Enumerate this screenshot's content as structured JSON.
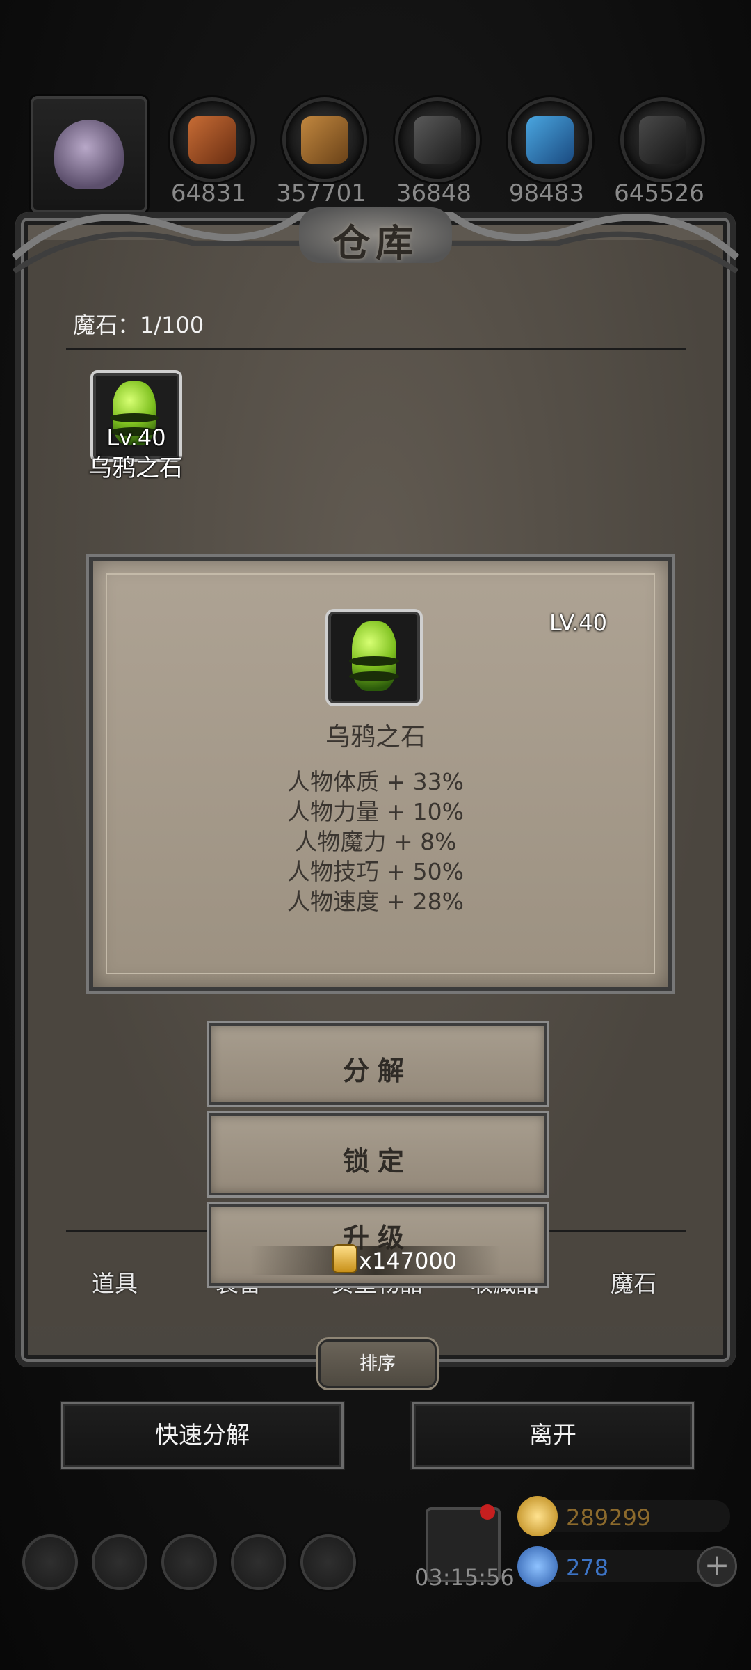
{
  "resources": {
    "values": [
      "64831",
      "357701",
      "36848",
      "98483",
      "645526"
    ]
  },
  "warehouse": {
    "title": "仓库",
    "capacity_label": "魔石：1/100"
  },
  "inventory": {
    "items": [
      {
        "level": "Lv.40",
        "name": "乌鸦之石"
      }
    ]
  },
  "detail": {
    "level": "LV.40",
    "name": "乌鸦之石",
    "stats": [
      "人物体质 + 33%",
      "人物力量 + 10%",
      "人物魔力 + 8%",
      "人物技巧 + 50%",
      "人物速度 + 28%"
    ]
  },
  "actions": {
    "decompose": "分解",
    "lock": "锁定",
    "upgrade": "升级",
    "upgrade_cost": "x147000"
  },
  "tabs": {
    "items": [
      "道具",
      "装备",
      "贵重物品",
      "收藏品",
      "魔石"
    ]
  },
  "buttons": {
    "sort": "排序",
    "quick_decompose": "快速分解",
    "leave": "离开"
  },
  "footer": {
    "timer": "03:15:56",
    "gold": "289299",
    "gems": "278"
  },
  "colors": {
    "gem_green": "#7fc120",
    "gold_text": "#8c6a2c",
    "gem_blue": "#3d74c6"
  }
}
